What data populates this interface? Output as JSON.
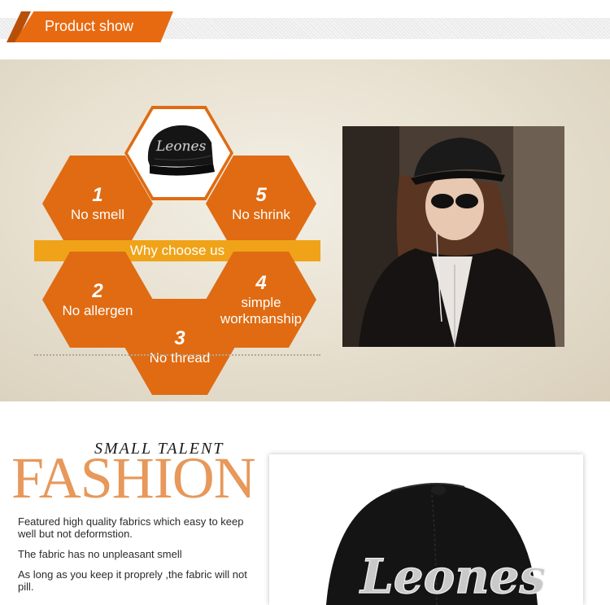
{
  "header": {
    "title": "Product show"
  },
  "features": {
    "why_label": "Why choose us",
    "items": [
      {
        "num": "1",
        "label": "No smell"
      },
      {
        "num": "5",
        "label": "No shrink"
      },
      {
        "num": "2",
        "label": "No allergen"
      },
      {
        "num": "4",
        "label": "simple\nworkmanship"
      },
      {
        "num": "3",
        "label": "No thread"
      }
    ]
  },
  "fashion": {
    "tagline": "SMALL TALENT",
    "headline": "FASHION",
    "paragraphs": [
      "Featured high quality fabrics which easy to keep well but not deformstion.",
      "The fabric has no unpleasant smell",
      "As long as you keep it proprely ,the fabric will not pill."
    ]
  },
  "cap_text": "Leones",
  "colors": {
    "accent": "#e86a10",
    "hex": "#e06b12",
    "bar": "#f0a318",
    "fashion": "#e7985a"
  }
}
